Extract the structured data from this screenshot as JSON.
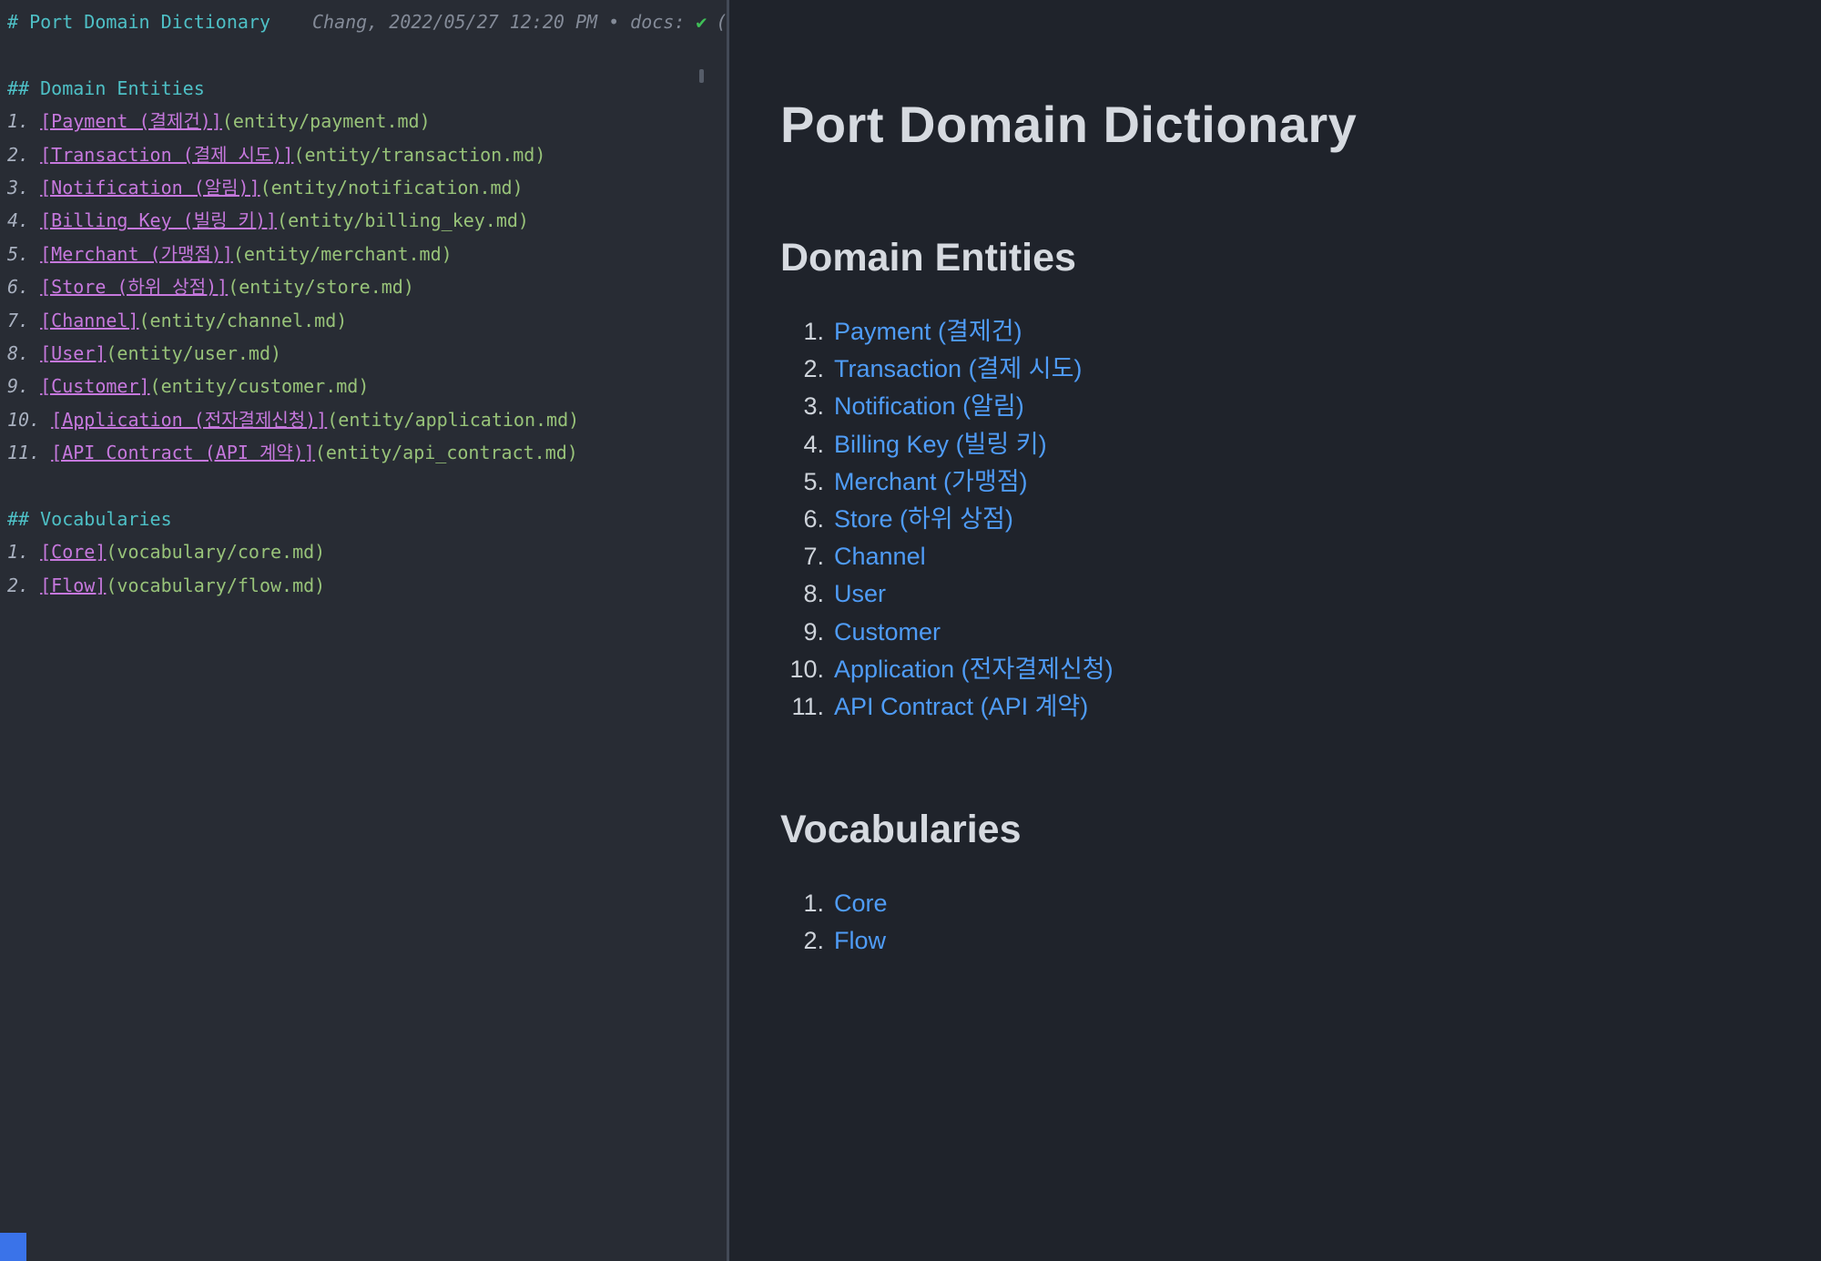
{
  "colors": {
    "editor-bg": "#282c34",
    "preview-bg": "#1f232b",
    "teal": "#4ec0c6",
    "purple": "#c678dd",
    "green": "#98c379",
    "meta-gray": "#848b98",
    "check-green": "#3fbf57",
    "link-blue": "#4f9cf7",
    "preview-text": "#d6dae0",
    "chip-blue": "#3a73e9",
    "divider": "#434a57"
  },
  "editor": {
    "title": {
      "heading": "# Port Domain Dictionary",
      "meta": "Chang, 2022/05/27 12:20 PM • docs:",
      "check": "✔",
      "trailing": "("
    },
    "sections": [
      {
        "heading": "## Domain Entities",
        "items": [
          {
            "num": "1.",
            "link": "[Payment (결제건)]",
            "url": "(entity/payment.md)"
          },
          {
            "num": "2.",
            "link": "[Transaction (결제 시도)]",
            "url": "(entity/transaction.md)"
          },
          {
            "num": "3.",
            "link": "[Notification (알림)]",
            "url": "(entity/notification.md)"
          },
          {
            "num": "4.",
            "link": "[Billing Key (빌링 키)]",
            "url": "(entity/billing_key.md)"
          },
          {
            "num": "5.",
            "link": "[Merchant (가맹점)]",
            "url": "(entity/merchant.md)"
          },
          {
            "num": "6.",
            "link": "[Store (하위 상점)]",
            "url": "(entity/store.md)"
          },
          {
            "num": "7.",
            "link": "[Channel]",
            "url": "(entity/channel.md)"
          },
          {
            "num": "8.",
            "link": "[User]",
            "url": "(entity/user.md)"
          },
          {
            "num": "9.",
            "link": "[Customer]",
            "url": "(entity/customer.md)"
          },
          {
            "num": "10.",
            "link": "[Application (전자결제신청)]",
            "url": "(entity/application.md)"
          },
          {
            "num": "11.",
            "link": "[API Contract (API 계약)]",
            "url": "(entity/api_contract.md)"
          }
        ]
      },
      {
        "heading": "## Vocabularies",
        "items": [
          {
            "num": "1.",
            "link": "[Core]",
            "url": "(vocabulary/core.md)"
          },
          {
            "num": "2.",
            "link": "[Flow]",
            "url": "(vocabulary/flow.md)"
          }
        ]
      }
    ]
  },
  "preview": {
    "title": "Port Domain Dictionary",
    "sections": [
      {
        "heading": "Domain Entities",
        "items": [
          {
            "num": "1.",
            "label": "Payment (결제건)"
          },
          {
            "num": "2.",
            "label": "Transaction (결제 시도)"
          },
          {
            "num": "3.",
            "label": "Notification (알림)"
          },
          {
            "num": "4.",
            "label": "Billing Key (빌링 키)"
          },
          {
            "num": "5.",
            "label": "Merchant (가맹점)"
          },
          {
            "num": "6.",
            "label": "Store (하위 상점)"
          },
          {
            "num": "7.",
            "label": "Channel"
          },
          {
            "num": "8.",
            "label": "User"
          },
          {
            "num": "9.",
            "label": "Customer"
          },
          {
            "num": "10.",
            "label": "Application (전자결제신청)"
          },
          {
            "num": "11.",
            "label": "API Contract (API 계약)"
          }
        ]
      },
      {
        "heading": "Vocabularies",
        "items": [
          {
            "num": "1.",
            "label": "Core"
          },
          {
            "num": "2.",
            "label": "Flow"
          }
        ]
      }
    ]
  }
}
